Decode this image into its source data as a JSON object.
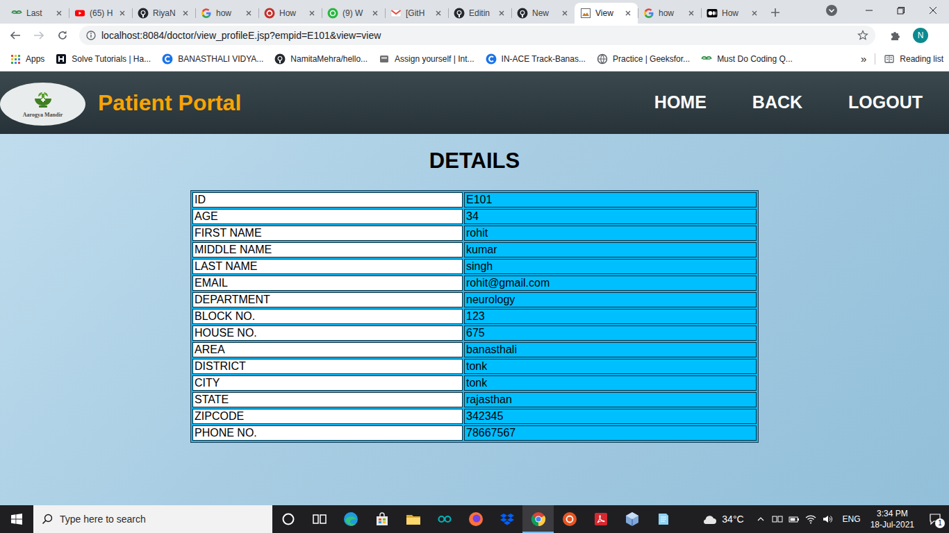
{
  "browser": {
    "tabs": [
      {
        "label": "Last",
        "kind": "gfg",
        "selected": false
      },
      {
        "label": "(65) H",
        "kind": "youtube",
        "selected": false
      },
      {
        "label": "RiyaN",
        "kind": "github",
        "selected": false
      },
      {
        "label": "how",
        "kind": "google",
        "selected": false
      },
      {
        "label": "How",
        "kind": "quora",
        "selected": false
      },
      {
        "label": "(9) W",
        "kind": "whatsapp",
        "selected": false
      },
      {
        "label": "[GitH",
        "kind": "gmail",
        "selected": false
      },
      {
        "label": "Editin",
        "kind": "github",
        "selected": false
      },
      {
        "label": "New",
        "kind": "github",
        "selected": false
      },
      {
        "label": "View",
        "kind": "page",
        "selected": true
      },
      {
        "label": "how",
        "kind": "google",
        "selected": false
      },
      {
        "label": "How",
        "kind": "medium",
        "selected": false
      }
    ],
    "forward_disabled": true,
    "url": "localhost:8084/doctor/view_profileE.jsp?empid=E101&view=view",
    "avatar": "N",
    "apps_label": "Apps",
    "bookmarks": [
      {
        "label": "Solve Tutorials | Ha...",
        "kind": "hackerrank"
      },
      {
        "label": "BANASTHALI VIDYA...",
        "kind": "blue-c"
      },
      {
        "label": "NamitaMehra/hello...",
        "kind": "github"
      },
      {
        "label": "Assign yourself | Int...",
        "kind": "box"
      },
      {
        "label": "IN-ACE Track-Banas...",
        "kind": "blue-c"
      },
      {
        "label": "Practice | Geeksfor...",
        "kind": "globe"
      },
      {
        "label": "Must Do Coding Q...",
        "kind": "gfg"
      }
    ],
    "more": "»",
    "reading_list": "Reading list"
  },
  "page": {
    "logo_caption": "Aarogya Mandir",
    "title": "Patient Portal",
    "nav": [
      "HOME",
      "BACK",
      "LOGOUT"
    ],
    "heading": "DETAILS",
    "details": [
      {
        "label": "ID",
        "value": "E101"
      },
      {
        "label": "AGE",
        "value": "34"
      },
      {
        "label": "FIRST NAME",
        "value": "rohit"
      },
      {
        "label": "MIDDLE NAME",
        "value": "kumar"
      },
      {
        "label": "LAST NAME",
        "value": "singh"
      },
      {
        "label": "EMAIL",
        "value": "rohit@gmail.com"
      },
      {
        "label": "DEPARTMENT",
        "value": "neurology"
      },
      {
        "label": "BLOCK NO.",
        "value": "123"
      },
      {
        "label": "HOUSE NO.",
        "value": "675"
      },
      {
        "label": "AREA",
        "value": "banasthali"
      },
      {
        "label": "DISTRICT",
        "value": "tonk"
      },
      {
        "label": "CITY",
        "value": "tonk"
      },
      {
        "label": "STATE",
        "value": "rajasthan"
      },
      {
        "label": "ZIPCODE",
        "value": "342345"
      },
      {
        "label": "PHONE NO.",
        "value": "78667567"
      }
    ]
  },
  "taskbar": {
    "search": {
      "placeholder": "Type here to search"
    },
    "apps": [
      {
        "kind": "cortana",
        "selected": false
      },
      {
        "kind": "taskview",
        "selected": false
      },
      {
        "kind": "edge",
        "selected": false
      },
      {
        "kind": "store",
        "selected": false
      },
      {
        "kind": "explorer",
        "selected": false
      },
      {
        "kind": "arduino",
        "selected": false
      },
      {
        "kind": "firefox",
        "selected": false
      },
      {
        "kind": "dropbox",
        "selected": false
      },
      {
        "kind": "chrome",
        "selected": true
      },
      {
        "kind": "ubuntu",
        "selected": false
      },
      {
        "kind": "acrobat",
        "selected": false
      },
      {
        "kind": "virtualbox",
        "selected": false
      },
      {
        "kind": "notes",
        "selected": false
      }
    ],
    "weather": "34°C",
    "language": "ENG",
    "time": "3:34 PM",
    "date": "18-Jul-2021",
    "notifications": "1"
  }
}
